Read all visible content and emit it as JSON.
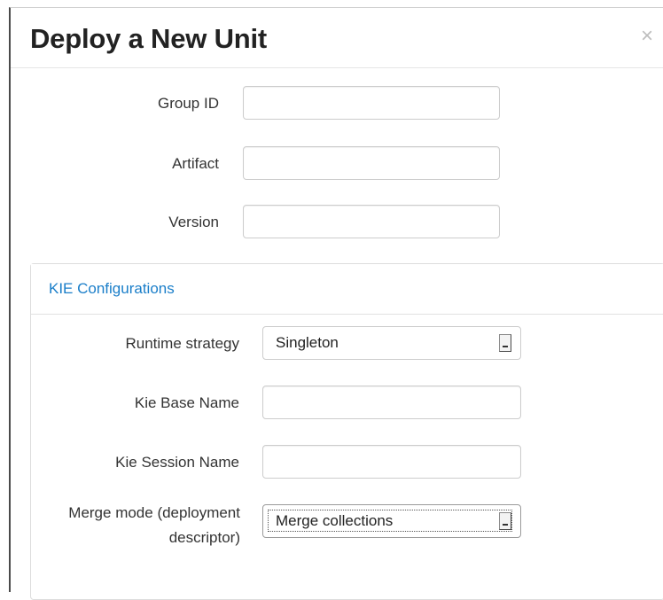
{
  "dialog": {
    "title": "Deploy a New Unit",
    "close_glyph": "×"
  },
  "form": {
    "group_id": {
      "label": "Group ID",
      "value": ""
    },
    "artifact": {
      "label": "Artifact",
      "value": ""
    },
    "version": {
      "label": "Version",
      "value": ""
    }
  },
  "kie": {
    "heading": "KIE Configurations",
    "runtime_strategy": {
      "label": "Runtime strategy",
      "selected": "Singleton"
    },
    "kie_base_name": {
      "label": "Kie Base Name",
      "value": ""
    },
    "kie_session_name": {
      "label": "Kie Session Name",
      "value": ""
    },
    "merge_mode": {
      "label_line1": "Merge mode (deployment",
      "label_line2": "descriptor)",
      "selected": "Merge collections"
    }
  },
  "colors": {
    "panel_heading_text": "#1a7ec9",
    "title_text": "#222222",
    "close_icon": "#bdbdbd"
  },
  "icons": {
    "close": "close-icon",
    "select_arrow": "dropdown-arrow-icon"
  }
}
